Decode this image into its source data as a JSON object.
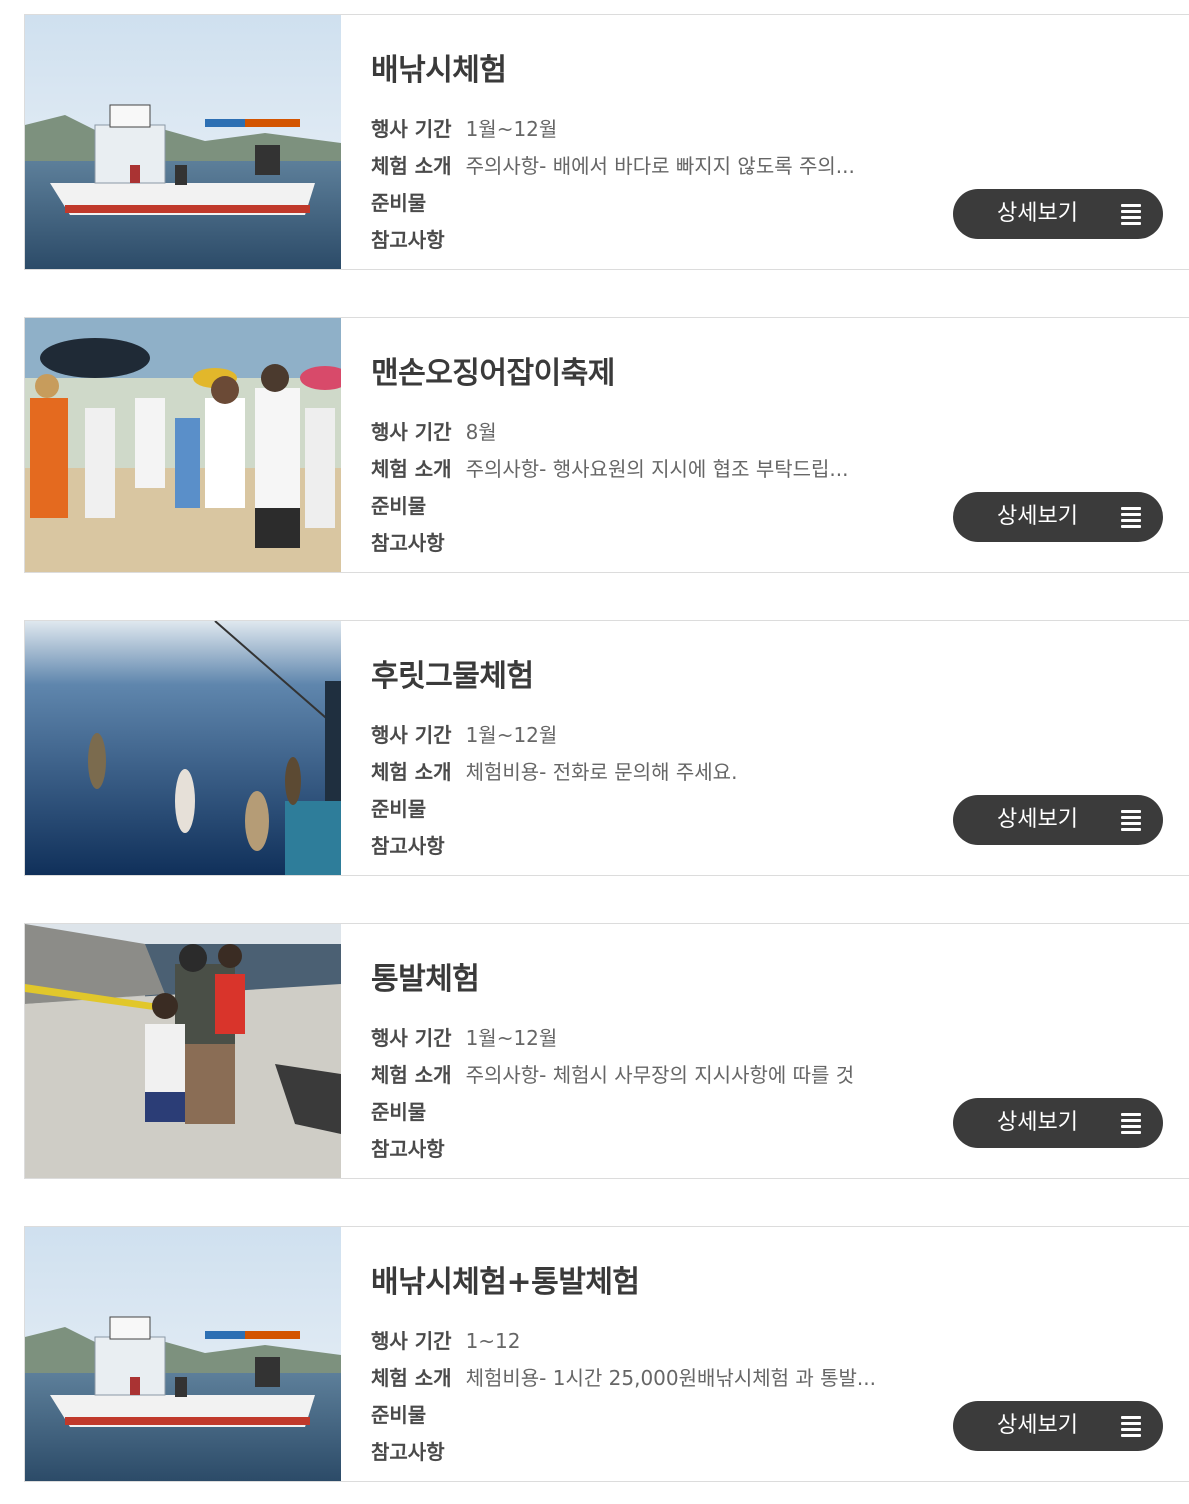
{
  "items": [
    {
      "title": "배낚시체험",
      "period_label": "행사 기간",
      "period": "1월~12월",
      "intro_label": "체험 소개",
      "intro": "주의사항- 배에서 바다로 빠지지 않도록 주의...",
      "prep_label": "준비물",
      "notes_label": "참고사항",
      "button_label": "상세보기",
      "image": "fishing-boat"
    },
    {
      "title": "맨손오징어잡이축제",
      "period_label": "행사 기간",
      "period": "8월",
      "intro_label": "체험 소개",
      "intro": "주의사항- 행사요원의 지시에 협조 부탁드립...",
      "prep_label": "준비물",
      "notes_label": "참고사항",
      "button_label": "상세보기",
      "image": "beach-festival-crowd"
    },
    {
      "title": "후릿그물체험",
      "period_label": "행사 기간",
      "period": "1월~12월",
      "intro_label": "체험 소개",
      "intro": "체험비용- 전화로 문의해 주세요.",
      "prep_label": "준비물",
      "notes_label": "참고사항",
      "button_label": "상세보기",
      "image": "fish-on-lines-over-sea"
    },
    {
      "title": "통발체험",
      "period_label": "행사 기간",
      "period": "1월~12월",
      "intro_label": "체험 소개",
      "intro": "주의사항- 체험시 사무장의 지시사항에 따를 것",
      "prep_label": "준비물",
      "notes_label": "참고사항",
      "button_label": "상세보기",
      "image": "family-at-pier"
    },
    {
      "title": "배낚시체험+통발체험",
      "period_label": "행사 기간",
      "period": "1~12",
      "intro_label": "체험 소개",
      "intro": "체험비용- 1시간 25,000원배낚시체험 과 통발...",
      "prep_label": "준비물",
      "notes_label": "참고사항",
      "button_label": "상세보기",
      "image": "fishing-boat"
    }
  ],
  "colors": {
    "button_bg": "#3b3b3b",
    "title": "#3a3a3a",
    "label": "#4a4a4a",
    "value": "#666666",
    "border": "#dcdcdc"
  }
}
